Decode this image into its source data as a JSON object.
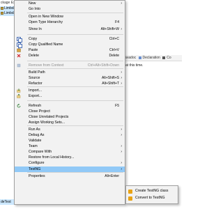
{
  "background": {
    "explorer_tab": "ckage Expl",
    "tree_items": [
      "Limbda",
      "Limbda"
    ],
    "tab_bar": [
      "avadoc",
      "Declaration",
      "Co"
    ],
    "status_text": "at this time.",
    "bottom_left_label": "deTest"
  },
  "menu": {
    "items": [
      {
        "label": "New",
        "shortcut": "",
        "submenu": true,
        "enabled": true,
        "icon": "none-icon"
      },
      {
        "label": "Go Into",
        "shortcut": "",
        "submenu": false,
        "enabled": true,
        "icon": "none-icon"
      },
      {
        "label": "Open in New Window",
        "shortcut": "",
        "submenu": false,
        "enabled": true,
        "icon": "none-icon"
      },
      {
        "label": "Open Type Hierarchy",
        "shortcut": "F4",
        "submenu": false,
        "enabled": true,
        "icon": "none-icon"
      },
      {
        "label": "Show In",
        "shortcut": "Alt+Shift+W",
        "submenu": true,
        "enabled": true,
        "icon": "none-icon"
      },
      {
        "label": "Copy",
        "shortcut": "Ctrl+C",
        "submenu": false,
        "enabled": true,
        "icon": "copy-icon"
      },
      {
        "label": "Copy Qualified Name",
        "shortcut": "",
        "submenu": false,
        "enabled": true,
        "icon": "copy-icon"
      },
      {
        "label": "Paste",
        "shortcut": "Ctrl+V",
        "submenu": false,
        "enabled": true,
        "icon": "paste-icon"
      },
      {
        "label": "Delete",
        "shortcut": "Delete",
        "submenu": false,
        "enabled": true,
        "icon": "delete-icon"
      },
      {
        "label": "Remove from Context",
        "shortcut": "Ctrl+Alt+Shift+Down",
        "submenu": false,
        "enabled": false,
        "icon": "remove-icon"
      },
      {
        "label": "Build Path",
        "shortcut": "",
        "submenu": true,
        "enabled": true,
        "icon": "none-icon"
      },
      {
        "label": "Source",
        "shortcut": "Alt+Shift+S",
        "submenu": true,
        "enabled": true,
        "icon": "none-icon"
      },
      {
        "label": "Refactor",
        "shortcut": "Alt+Shift+T",
        "submenu": true,
        "enabled": true,
        "icon": "none-icon"
      },
      {
        "label": "Import...",
        "shortcut": "",
        "submenu": false,
        "enabled": true,
        "icon": "import-icon"
      },
      {
        "label": "Export...",
        "shortcut": "",
        "submenu": false,
        "enabled": true,
        "icon": "export-icon"
      },
      {
        "label": "Refresh",
        "shortcut": "F5",
        "submenu": false,
        "enabled": true,
        "icon": "refresh-icon"
      },
      {
        "label": "Close Project",
        "shortcut": "",
        "submenu": false,
        "enabled": true,
        "icon": "none-icon"
      },
      {
        "label": "Close Unrelated Projects",
        "shortcut": "",
        "submenu": false,
        "enabled": true,
        "icon": "none-icon"
      },
      {
        "label": "Assign Working Sets...",
        "shortcut": "",
        "submenu": false,
        "enabled": true,
        "icon": "none-icon"
      },
      {
        "label": "Run As",
        "shortcut": "",
        "submenu": true,
        "enabled": true,
        "icon": "none-icon"
      },
      {
        "label": "Debug As",
        "shortcut": "",
        "submenu": true,
        "enabled": true,
        "icon": "none-icon"
      },
      {
        "label": "Validate",
        "shortcut": "",
        "submenu": false,
        "enabled": true,
        "icon": "none-icon"
      },
      {
        "label": "Team",
        "shortcut": "",
        "submenu": true,
        "enabled": true,
        "icon": "none-icon"
      },
      {
        "label": "Compare With",
        "shortcut": "",
        "submenu": true,
        "enabled": true,
        "icon": "none-icon"
      },
      {
        "label": "Restore from Local History...",
        "shortcut": "",
        "submenu": false,
        "enabled": true,
        "icon": "none-icon"
      },
      {
        "label": "Configure",
        "shortcut": "",
        "submenu": true,
        "enabled": true,
        "icon": "none-icon"
      },
      {
        "label": "TestNG",
        "shortcut": "",
        "submenu": true,
        "enabled": true,
        "icon": "none-icon",
        "highlighted": true
      },
      {
        "label": "Properties",
        "shortcut": "Alt+Enter",
        "submenu": false,
        "enabled": true,
        "icon": "none-icon"
      }
    ]
  },
  "submenu": {
    "items": [
      {
        "label": "Create TestNG class",
        "icon": "testng-icon"
      },
      {
        "label": "Convert to TestNG",
        "icon": "testng-icon"
      }
    ]
  },
  "colors": {
    "highlight": "#91c9f7",
    "menu_bg": "#f2f2f2",
    "selection_bg": "#cce8ff",
    "testng_icon": "#e8a317"
  }
}
